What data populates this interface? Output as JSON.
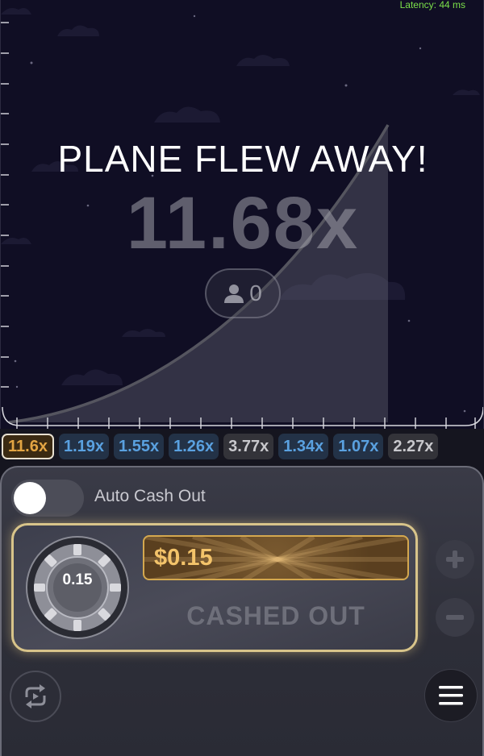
{
  "status": {
    "latency": "Latency: 44 ms"
  },
  "round": {
    "headline": "PLANE FLEW AWAY!",
    "multiplier": "11.68x",
    "players_count": "0"
  },
  "history": [
    {
      "value": "11.6x",
      "tone": "gold"
    },
    {
      "value": "1.19x",
      "tone": "blue"
    },
    {
      "value": "1.55x",
      "tone": "blue"
    },
    {
      "value": "1.26x",
      "tone": "blue"
    },
    {
      "value": "3.77x",
      "tone": "gray"
    },
    {
      "value": "1.34x",
      "tone": "blue"
    },
    {
      "value": "1.07x",
      "tone": "blue"
    },
    {
      "value": "2.27x",
      "tone": "gray"
    }
  ],
  "controls": {
    "auto_cash_out_label": "Auto Cash Out",
    "auto_cash_out_on": false,
    "bet_amount": "0.15",
    "win_amount": "$0.15",
    "state_label": "CASHED OUT",
    "plus_icon": "plus-icon",
    "minus_icon": "minus-icon",
    "autoplay_icon": "repeat-icon",
    "menu_icon": "hamburger-menu-icon"
  },
  "colors": {
    "background": "#100e24",
    "latency": "#7be04a",
    "gold": "#e3a543",
    "blue_chip_text": "#5aa1e0",
    "panel_border": "#d8c48a"
  }
}
